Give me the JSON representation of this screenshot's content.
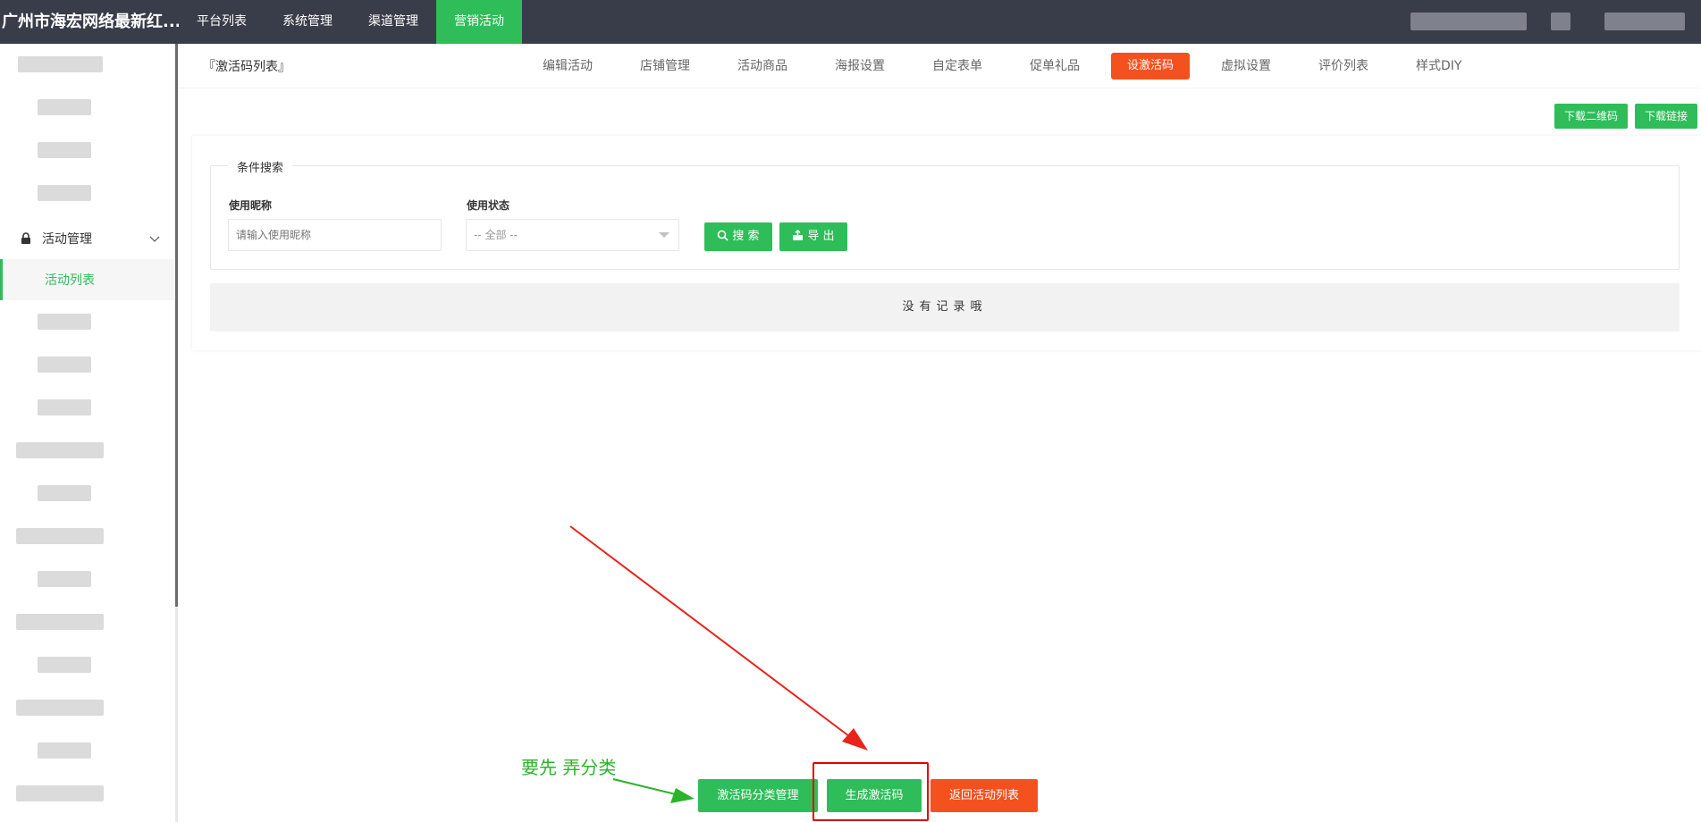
{
  "header": {
    "brand": "广州市海宏网络最新红...",
    "nav": [
      "平台列表",
      "系统管理",
      "渠道管理",
      "营销活动"
    ],
    "active_nav": "营销活动"
  },
  "sidebar": {
    "group_label": "活动管理",
    "active_item": "活动列表"
  },
  "subheader": {
    "breadcrumb": "『激活码列表』",
    "tabs": [
      "编辑活动",
      "店铺管理",
      "活动商品",
      "海报设置",
      "自定表单",
      "促单礼品",
      "设激活码",
      "虚拟设置",
      "评价列表",
      "样式DIY"
    ],
    "active_tab": "设激活码"
  },
  "toolbar": {
    "download_qr": "下载二维码",
    "download_link": "下载链接"
  },
  "search": {
    "legend": "条件搜索",
    "nickname_label": "使用昵称",
    "nickname_placeholder": "请输入使用昵称",
    "status_label": "使用状态",
    "status_selected": "-- 全部 --",
    "search_btn": "搜 索",
    "export_btn": "导 出"
  },
  "table": {
    "empty_text": "没有记录哦"
  },
  "footer": {
    "category_btn": "激活码分类管理",
    "generate_btn": "生成激活码",
    "back_btn": "返回活动列表"
  },
  "annotation": {
    "note": "要先 弄分类",
    "arrow_color": "#e8231a",
    "note_color": "#2bb32b"
  },
  "colors": {
    "primary": "#2ebd59",
    "danger": "#f4511e",
    "header_bg": "#393d49"
  }
}
